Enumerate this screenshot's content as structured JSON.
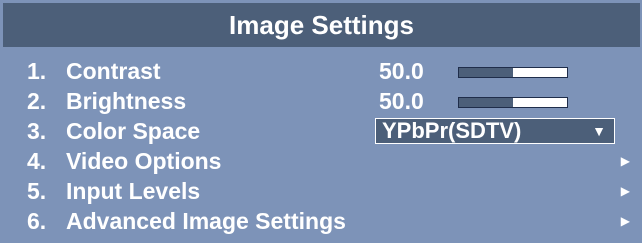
{
  "title": "Image Settings",
  "items": [
    {
      "number": "1.",
      "label": "Contrast",
      "value": "50.0",
      "level": 0.5
    },
    {
      "number": "2.",
      "label": "Brightness",
      "value": "50.0",
      "level": 0.5
    },
    {
      "number": "3.",
      "label": "Color Space",
      "selected": "YPbPr(SDTV)"
    },
    {
      "number": "4.",
      "label": "Video Options"
    },
    {
      "number": "5.",
      "label": "Input Levels"
    },
    {
      "number": "6.",
      "label": "Advanced Image Settings"
    }
  ],
  "icons": {
    "dropdown": "triangle-down-icon",
    "submenu": "triangle-right-icon"
  },
  "colors": {
    "panel": "#7d93b8",
    "title_bar": "#4c5f79",
    "text": "#ffffff"
  }
}
